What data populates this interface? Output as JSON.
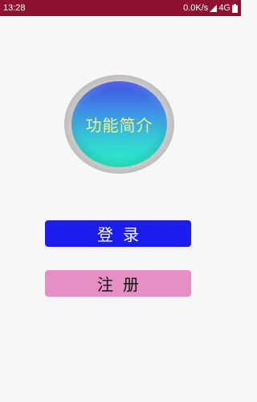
{
  "status_bar": {
    "time": "13:28",
    "net_speed": "0.0K/s",
    "network": "4G",
    "colors": {
      "background": "#8e1132",
      "text": "#ffffff"
    },
    "icons": [
      "signal-icon",
      "battery-icon"
    ]
  },
  "main": {
    "intro_button_label": "功能简介",
    "login_label": "登录",
    "register_label": "注册",
    "colors": {
      "intro_label": "#f4f38a",
      "login_bg": "#1a1ded",
      "register_bg": "#e58fc5"
    }
  }
}
